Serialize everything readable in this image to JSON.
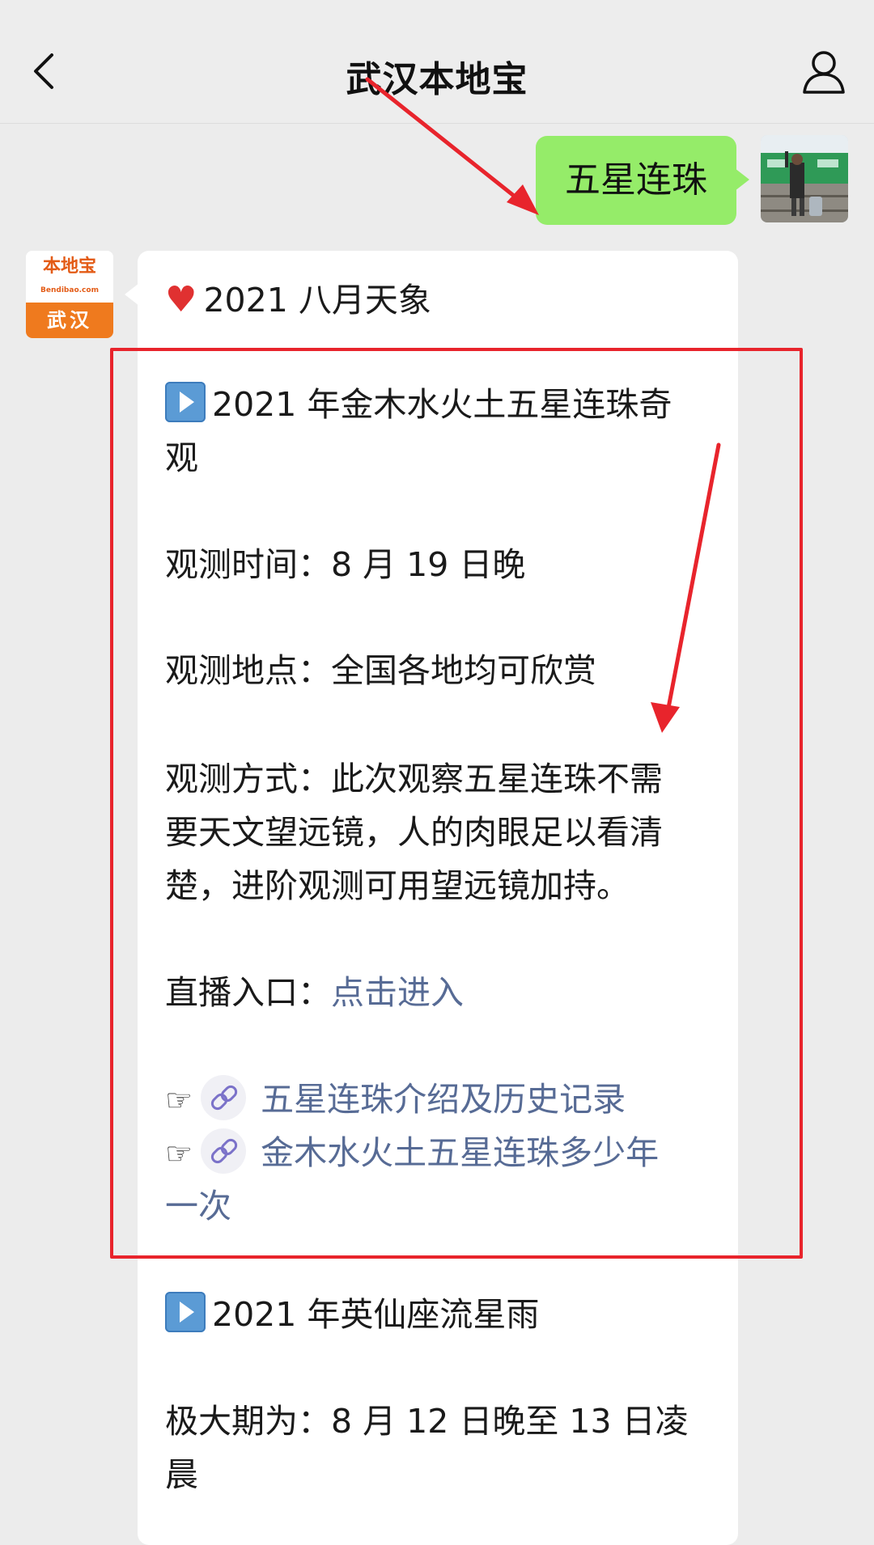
{
  "header": {
    "title": "武汉本地宝",
    "back_icon": "chevron-left-icon",
    "profile_icon": "person-icon"
  },
  "user_message": {
    "text": "五星连珠"
  },
  "bot": {
    "avatar_logo": "本地宝",
    "avatar_subtext": "Bendibao.com",
    "avatar_city": "武汉"
  },
  "reply": {
    "heading": "2021 八月天象",
    "section1": {
      "title_line1": "2021 年金木水火土五星连珠奇",
      "title_line2": "观",
      "time": "观测时间：8 月 19 日晚",
      "place": "观测地点：全国各地均可欣赏",
      "method_line1": "观测方式：此次观察五星连珠不需",
      "method_line2": "要天文望远镜，人的肉眼足以看清",
      "method_line3": "楚，进阶观测可用望远镜加持。",
      "live_label": "直播入口：",
      "live_link": "点击进入",
      "link1": "五星连珠介绍及历史记录",
      "link2_line1": "金木水火土五星连珠多少年",
      "link2_line2": "一次"
    },
    "section2": {
      "title": "2021 年英仙座流星雨",
      "peak_line1": "极大期为：8 月 12 日晚至 13 日凌",
      "peak_line2": "晨"
    }
  },
  "colors": {
    "user_bubble": "#95ec69",
    "link": "#576b95",
    "highlight_box": "#e8242c",
    "annotation_arrow": "#e8242c"
  }
}
